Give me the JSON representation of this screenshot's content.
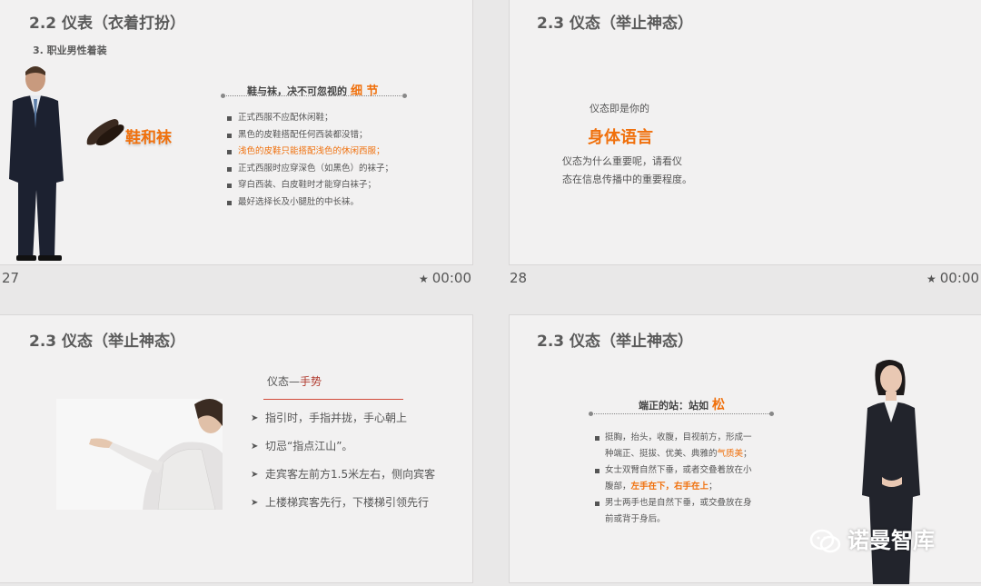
{
  "slides": [
    {
      "title": "2.2  仪表（衣着打扮）",
      "subtitle": "3. 职业男性着装",
      "shoe_label": "鞋和袜",
      "heading_prefix": "鞋与袜，决不可忽视的",
      "heading_highlight": "细 节",
      "bullets": [
        "正式西服不应配休闲鞋；",
        "黑色的皮鞋搭配任何西装都没错；",
        "浅色的皮鞋只能搭配浅色的休闲西服；",
        "正式西服时应穿深色（如黑色）的袜子；",
        "穿白西装、白皮鞋时才能穿白袜子；",
        "最好选择长及小腿肚的中长袜。"
      ],
      "number": "27",
      "time": "00:00"
    },
    {
      "title": "2.3  仪态（举止神态）",
      "line1": "仪态即是你的",
      "emphasis": "身体语言",
      "line2": "仪态为什么重要呢，请看仪",
      "line3": "态在信息传播中的重要程度。",
      "number": "28",
      "time": "00:00"
    },
    {
      "title": "2.3  仪态（举止神态）",
      "heading_prefix": "仪态—",
      "heading_highlight": "手势",
      "items": [
        "指引时，手指并拢，手心朝上",
        "切忌“指点江山”。",
        "走宾客左前方1.5米左右，侧向宾客",
        "上楼梯宾客先行，下楼梯引领先行"
      ]
    },
    {
      "title": "2.3  仪态（举止神态）",
      "heading_prefix": "端正的站：站如",
      "heading_highlight": "松",
      "b1_a": "挺胸，抬头，收腹，目视前方，形成一",
      "b1_b": "种端正、挺拔、优美、典雅的",
      "b1_c": "气质美",
      "b1_d": "；",
      "b2_a": "女士双臂自然下垂，或者交叠着放在小",
      "b2_b": "腹部，",
      "b2_c": "左手在下，右手在上",
      "b2_d": "；",
      "b3_a": "男士两手也是自然下垂，或交叠放在身",
      "b3_b": "前或背于身后。",
      "watermark": "诺曼智库"
    }
  ],
  "colors": {
    "accent": "#f0700c",
    "text": "#555555",
    "background": "#e9e8e8"
  }
}
